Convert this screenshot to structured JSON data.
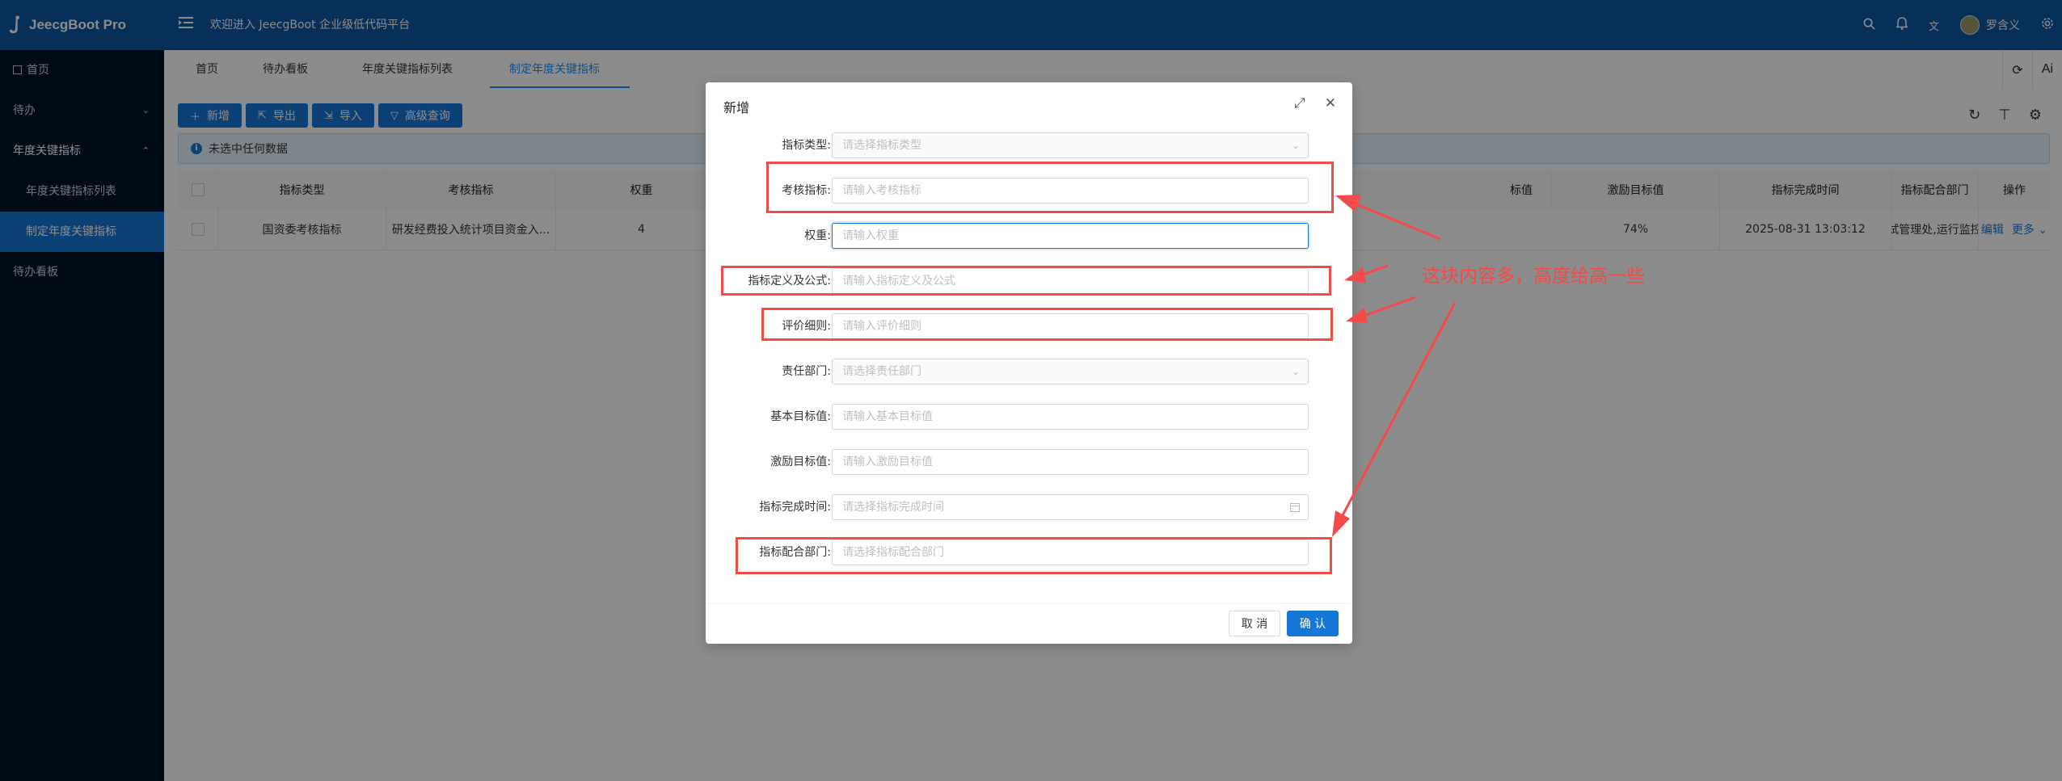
{
  "app": {
    "title": "JeecgBoot Pro",
    "welcome": "欢迎进入 JeecgBoot 企业级低代码平台",
    "user": "罗含义"
  },
  "sidebar": {
    "items": [
      {
        "label": "首页",
        "icon": "home-icon"
      },
      {
        "label": "待办"
      },
      {
        "label": "年度关键指标"
      },
      {
        "label": "年度关键指标列表"
      },
      {
        "label": "制定年度关键指标"
      },
      {
        "label": "待办看板"
      }
    ]
  },
  "tabs": [
    "首页",
    "待办看板",
    "年度关键指标列表",
    "制定年度关键指标"
  ],
  "tab_tools": {
    "ai": "Ai"
  },
  "toolbar": {
    "add": "新增",
    "export": "导出",
    "import": "导入",
    "advanced": "高级查询"
  },
  "alert": "未选中任何数据",
  "table": {
    "headers": [
      "指标类型",
      "考核指标",
      "权重",
      "标值",
      "激励目标值",
      "指标完成时间",
      "指标配合部门",
      "操作"
    ],
    "row": [
      "国资委考核指标",
      "研发经费投入统计项目资金入...",
      "4",
      "74%",
      "2025-08-31 13:03:12",
      "修试管理处,运行监控处"
    ],
    "edit": "编辑",
    "more": "更多"
  },
  "modal": {
    "title": "新增",
    "fields": [
      {
        "label": "指标类型:",
        "placeholder": "请选择指标类型"
      },
      {
        "label": "考核指标:",
        "placeholder": "请输入考核指标"
      },
      {
        "label": "权重:",
        "placeholder": "请输入权重"
      },
      {
        "label": "指标定义及公式:",
        "placeholder": "请输入指标定义及公式"
      },
      {
        "label": "评价细则:",
        "placeholder": "请输入评价细则"
      },
      {
        "label": "责任部门:",
        "placeholder": "请选择责任部门"
      },
      {
        "label": "基本目标值:",
        "placeholder": "请输入基本目标值"
      },
      {
        "label": "激励目标值:",
        "placeholder": "请输入激励目标值"
      },
      {
        "label": "指标完成时间:",
        "placeholder": "请选择指标完成时间"
      },
      {
        "label": "指标配合部门:",
        "placeholder": "请选择指标配合部门"
      }
    ],
    "cancel": "取 消",
    "ok": "确 认"
  },
  "annotation": {
    "text": "这块内容多，高度给高一些",
    "color": "#f44a4a"
  }
}
